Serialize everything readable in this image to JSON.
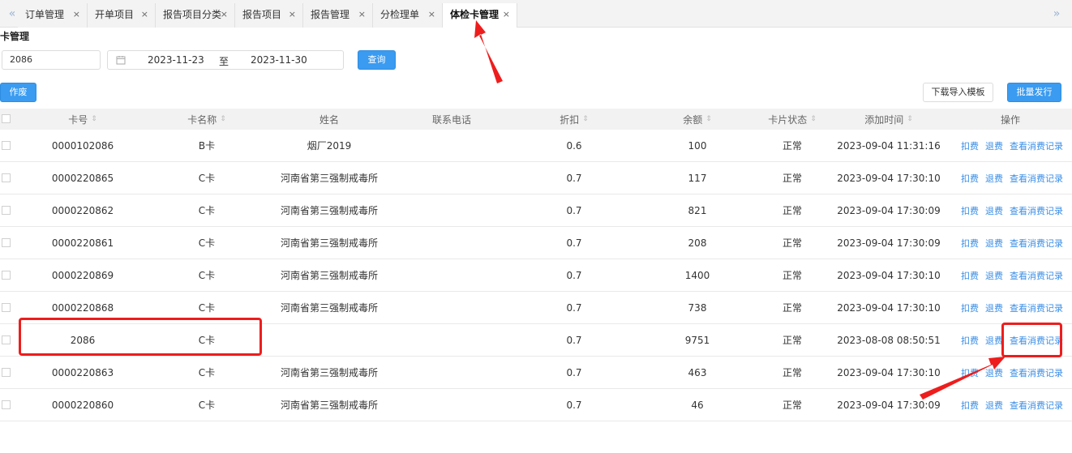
{
  "tabs": [
    {
      "label": "订单管理",
      "active": false
    },
    {
      "label": "开单项目",
      "active": false
    },
    {
      "label": "报告项目分类",
      "active": false
    },
    {
      "label": "报告项目",
      "active": false
    },
    {
      "label": "报告管理",
      "active": false
    },
    {
      "label": "分检理单",
      "active": false
    },
    {
      "label": "体检卡管理",
      "active": true
    }
  ],
  "nav": {
    "prev": "«",
    "next": "»",
    "close": "×"
  },
  "page_title": "卡管理",
  "filter": {
    "card_no": "2086",
    "calendar_icon": "calendar-icon",
    "date_from": "2023-11-23",
    "date_sep": "至",
    "date_to": "2023-11-30",
    "query_label": "查询"
  },
  "toolbar": {
    "void_label": "作废",
    "download_template_label": "下载导入模板",
    "batch_issue_label": "批量发行"
  },
  "columns": {
    "card_no": "卡号",
    "card_name": "卡名称",
    "name": "姓名",
    "phone": "联系电话",
    "discount": "折扣",
    "balance": "余额",
    "status": "卡片状态",
    "added": "添加时间",
    "ops": "操作"
  },
  "sort_icon": "⇕",
  "actions": {
    "deduct": "扣费",
    "refund": "退费",
    "view_records": "查看消费记录"
  },
  "rows": [
    {
      "card_no": "0000102086",
      "card_name": "B卡",
      "name": "烟厂2019",
      "phone": "",
      "discount": "0.6",
      "balance": "100",
      "status": "正常",
      "added": "2023-09-04 11:31:16"
    },
    {
      "card_no": "0000220865",
      "card_name": "C卡",
      "name": "河南省第三强制戒毒所",
      "phone": "",
      "discount": "0.7",
      "balance": "117",
      "status": "正常",
      "added": "2023-09-04 17:30:10"
    },
    {
      "card_no": "0000220862",
      "card_name": "C卡",
      "name": "河南省第三强制戒毒所",
      "phone": "",
      "discount": "0.7",
      "balance": "821",
      "status": "正常",
      "added": "2023-09-04 17:30:09"
    },
    {
      "card_no": "0000220861",
      "card_name": "C卡",
      "name": "河南省第三强制戒毒所",
      "phone": "",
      "discount": "0.7",
      "balance": "208",
      "status": "正常",
      "added": "2023-09-04 17:30:09"
    },
    {
      "card_no": "0000220869",
      "card_name": "C卡",
      "name": "河南省第三强制戒毒所",
      "phone": "",
      "discount": "0.7",
      "balance": "1400",
      "status": "正常",
      "added": "2023-09-04 17:30:10"
    },
    {
      "card_no": "0000220868",
      "card_name": "C卡",
      "name": "河南省第三强制戒毒所",
      "phone": "",
      "discount": "0.7",
      "balance": "738",
      "status": "正常",
      "added": "2023-09-04 17:30:10"
    },
    {
      "card_no": "2086",
      "card_name": "C卡",
      "name": "",
      "phone": "",
      "discount": "0.7",
      "balance": "9751",
      "status": "正常",
      "added": "2023-08-08 08:50:51"
    },
    {
      "card_no": "0000220863",
      "card_name": "C卡",
      "name": "河南省第三强制戒毒所",
      "phone": "",
      "discount": "0.7",
      "balance": "463",
      "status": "正常",
      "added": "2023-09-04 17:30:10"
    },
    {
      "card_no": "0000220860",
      "card_name": "C卡",
      "name": "河南省第三强制戒毒所",
      "phone": "",
      "discount": "0.7",
      "balance": "46",
      "status": "正常",
      "added": "2023-09-04 17:30:09"
    }
  ],
  "annotation_color": "#ee1d1d"
}
